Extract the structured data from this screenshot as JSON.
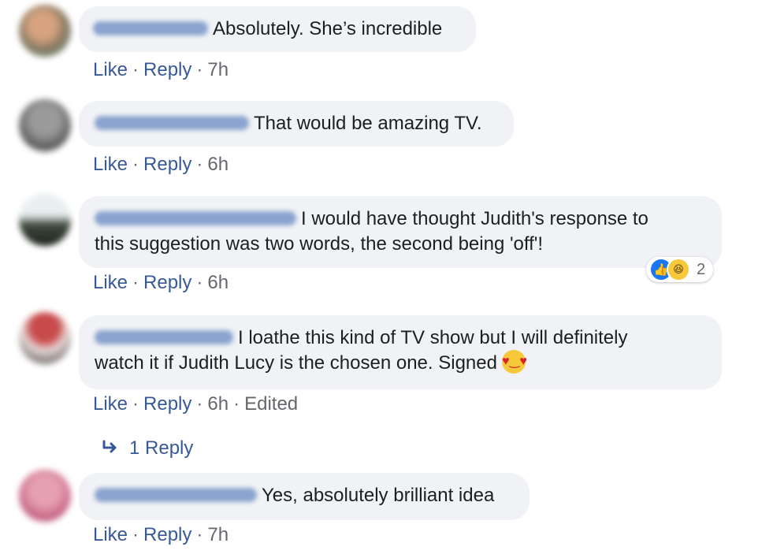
{
  "comments": [
    {
      "text": "Absolutely. She’s incredible",
      "actions": {
        "like": "Like",
        "reply": "Reply",
        "time": "7h"
      }
    },
    {
      "text": "That would be amazing TV.",
      "actions": {
        "like": "Like",
        "reply": "Reply",
        "time": "6h"
      }
    },
    {
      "text_line1": "I would have thought Judith's response to",
      "text_line2": "this suggestion was two words, the second being 'off'!",
      "actions": {
        "like": "Like",
        "reply": "Reply",
        "time": "6h"
      },
      "reactions": {
        "count": "2",
        "types": [
          "like-icon",
          "haha-icon"
        ]
      }
    },
    {
      "text_line1": "I loathe this kind of TV show but I will definitely",
      "text_line2": "watch it if Judith Lucy is the chosen one. Signed",
      "emoji": "heart-eyes-emoji",
      "actions": {
        "like": "Like",
        "reply": "Reply",
        "time": "6h",
        "edited": "Edited"
      }
    },
    {
      "text": "Yes, absolutely brilliant idea",
      "actions": {
        "like": "Like",
        "reply": "Reply",
        "time": "7h"
      }
    }
  ],
  "reply_thread": {
    "label": "1 Reply"
  },
  "colors": {
    "link": "#385898",
    "bubble": "#f0f2f5",
    "meta": "#65676b"
  }
}
